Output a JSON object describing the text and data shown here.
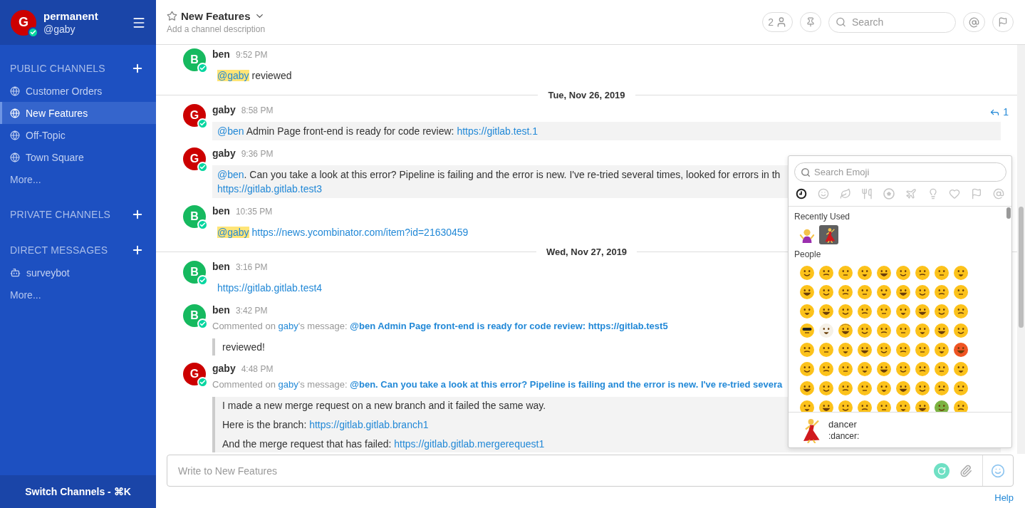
{
  "sidebar": {
    "team": {
      "name": "permanent",
      "user": "@gaby",
      "avatar_letter": "G",
      "color": "#cc0000",
      "online": true
    },
    "sections": [
      {
        "title": "PUBLIC CHANNELS",
        "items": [
          {
            "kind": "channel",
            "label": "Customer Orders",
            "selected": false
          },
          {
            "kind": "channel",
            "label": "New Features",
            "selected": true
          },
          {
            "kind": "channel",
            "label": "Off-Topic",
            "selected": false
          },
          {
            "kind": "channel",
            "label": "Town Square",
            "selected": false
          }
        ],
        "more": "More..."
      },
      {
        "title": "PRIVATE CHANNELS"
      },
      {
        "title": "DIRECT MESSAGES",
        "items": [
          {
            "kind": "bot",
            "label": "surveybot",
            "selected": false
          }
        ],
        "more": "More..."
      }
    ],
    "switch_channels": "Switch Channels - ⌘K"
  },
  "channel_header": {
    "name": "New Features",
    "favorite": false,
    "description": "Add a channel description",
    "member_count": "2",
    "search_placeholder": "Search"
  },
  "posts": [
    {
      "kind": "post",
      "author": "ben",
      "time": "9:52 PM",
      "avatar_letter": "B",
      "color": "#16b95f",
      "online": true,
      "highlighted": false,
      "lines": [
        [
          {
            "kind": "self_mention",
            "text": "@gaby"
          },
          {
            "kind": "text",
            "text": " reviewed"
          }
        ]
      ]
    },
    {
      "kind": "separator",
      "date": "Tue, Nov 26, 2019"
    },
    {
      "kind": "post",
      "author": "gaby",
      "time": "8:58 PM",
      "avatar_letter": "G",
      "color": "#cc0000",
      "online": true,
      "highlighted": true,
      "replies": "1",
      "lines": [
        [
          {
            "kind": "mention",
            "text": "@ben"
          },
          {
            "kind": "text",
            "text": " Admin Page front-end is ready for code review: "
          },
          {
            "kind": "link",
            "text": "https://gitlab.test.1"
          }
        ]
      ]
    },
    {
      "kind": "post",
      "author": "gaby",
      "time": "9:36 PM",
      "avatar_letter": "G",
      "color": "#cc0000",
      "online": true,
      "highlighted": true,
      "lines": [
        [
          {
            "kind": "mention",
            "text": "@ben"
          },
          {
            "kind": "text",
            "text": ". Can you take a look at this error? Pipeline is failing and the error is new. I've re-tried several times, looked for errors in th"
          }
        ],
        [
          {
            "kind": "link",
            "text": "https://gitlab.gitlab.test3"
          }
        ]
      ]
    },
    {
      "kind": "post",
      "author": "ben",
      "time": "10:35 PM",
      "avatar_letter": "B",
      "color": "#16b95f",
      "online": true,
      "highlighted": false,
      "lines": [
        [
          {
            "kind": "self_mention",
            "text": "@gaby",
            "space_after": true
          },
          {
            "kind": "link",
            "text": "https://news.ycombinator.com/item?id=21630459"
          }
        ]
      ]
    },
    {
      "kind": "separator",
      "date": "Wed, Nov 27, 2019"
    },
    {
      "kind": "post",
      "author": "ben",
      "time": "3:16 PM",
      "avatar_letter": "B",
      "color": "#16b95f",
      "online": true,
      "highlighted": false,
      "lines": [
        [
          {
            "kind": "link",
            "text": "https://gitlab.gitlab.test4"
          }
        ]
      ]
    },
    {
      "kind": "post",
      "author": "ben",
      "time": "3:42 PM",
      "avatar_letter": "B",
      "color": "#16b95f",
      "online": true,
      "highlighted": false,
      "comment_on": {
        "prefix": "Commented on",
        "user": "gaby",
        "suffix": "'s message:",
        "message": "@ben Admin Page front-end is ready for code review: https://gitlab.test5"
      },
      "quote": [
        [
          {
            "kind": "text",
            "text": "reviewed!"
          }
        ]
      ]
    },
    {
      "kind": "post",
      "author": "gaby",
      "time": "4:48 PM",
      "avatar_letter": "G",
      "color": "#cc0000",
      "online": true,
      "highlighted": true,
      "comment_on": {
        "prefix": "Commented on",
        "user": "gaby",
        "suffix": "'s message:",
        "message": "@ben. Can you take a look at this error? Pipeline is failing and the error is new. I've re-tried severa"
      },
      "quote": [
        [
          {
            "kind": "text",
            "text": "I made a new merge request on a new branch and it failed the same way."
          }
        ],
        [
          {
            "kind": "text",
            "text": "Here is the branch: "
          },
          {
            "kind": "link",
            "text": "https://gitlab.gitlab.branch1"
          }
        ],
        [
          {
            "kind": "text",
            "text": "And the merge request that has failed: "
          },
          {
            "kind": "link",
            "text": "https://gitlab.gitlab.mergerequest1"
          }
        ]
      ]
    }
  ],
  "emoji_picker": {
    "placeholder": "Search Emoji",
    "categories": [
      {
        "kind": "recent",
        "selected": true
      },
      {
        "kind": "people",
        "selected": false
      },
      {
        "kind": "nature",
        "selected": false
      },
      {
        "kind": "food",
        "selected": false
      },
      {
        "kind": "activity",
        "selected": false
      },
      {
        "kind": "travel",
        "selected": false
      },
      {
        "kind": "objects",
        "selected": false
      },
      {
        "kind": "symbols",
        "selected": false
      },
      {
        "kind": "flags",
        "selected": false
      },
      {
        "kind": "custom",
        "selected": false
      }
    ],
    "sections": [
      {
        "kind": "recent",
        "title": "Recently Used",
        "emojis": [
          {
            "kind": "shrug",
            "selected": false
          },
          {
            "kind": "dancer",
            "selected": true
          }
        ]
      },
      {
        "kind": "people",
        "title": "People"
      }
    ],
    "preview": {
      "kind": "dancer",
      "name": "dancer",
      "shortcode": ":dancer:"
    }
  },
  "composer": {
    "placeholder": "Write to New Features"
  },
  "help": "Help"
}
